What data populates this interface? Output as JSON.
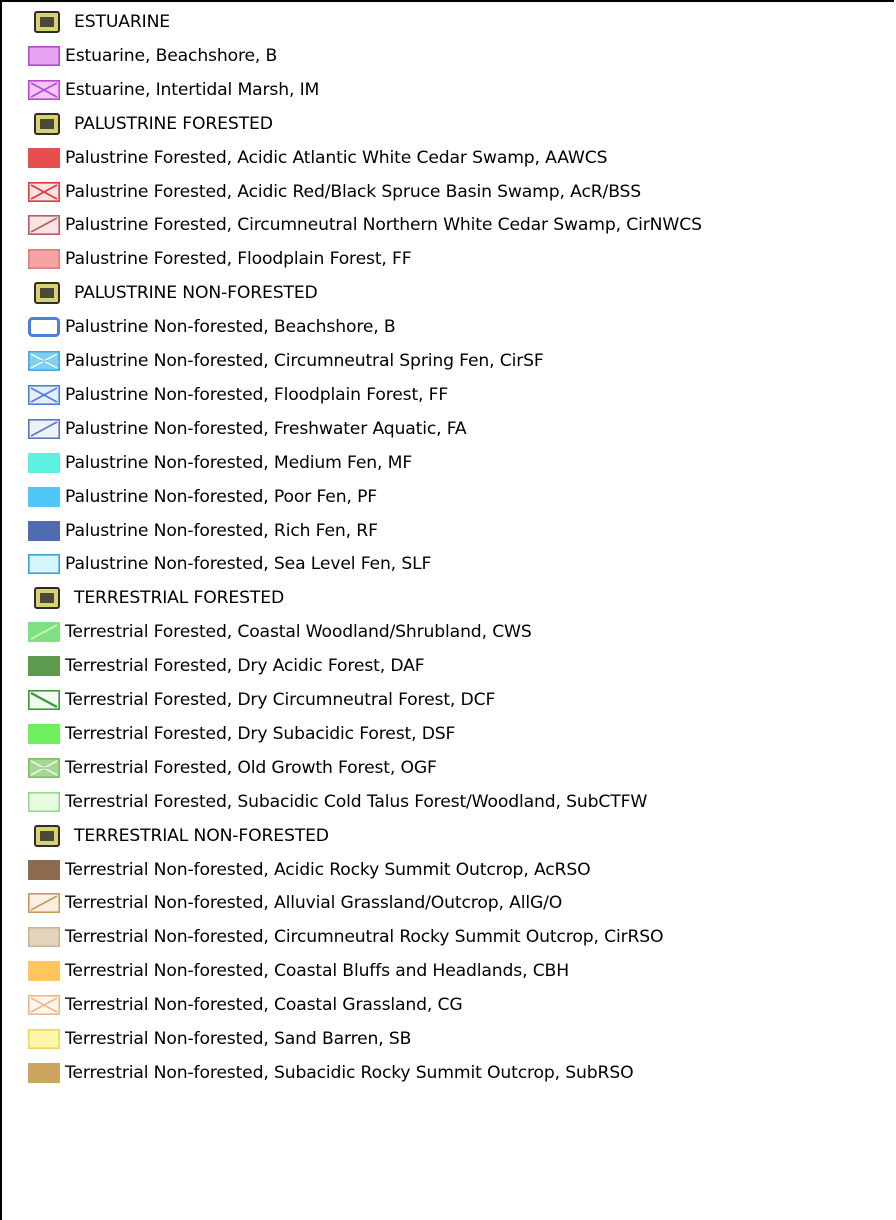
{
  "legend": {
    "rows": [
      {
        "kind": "header",
        "label": "ESTUARINE",
        "icon": "layer-group-icon"
      },
      {
        "kind": "item",
        "label": "Estuarine, Beachshore, B",
        "fill": "#e6a3f2",
        "border": "#b04bcc",
        "pattern": "solid"
      },
      {
        "kind": "item",
        "label": "Estuarine, Intertidal Marsh, IM",
        "fill": "#f3c8f8",
        "border": "#b84ad0",
        "pattern": "cross"
      },
      {
        "kind": "header",
        "label": "PALUSTRINE FORESTED",
        "icon": "layer-group-icon"
      },
      {
        "kind": "item",
        "label": "Palustrine Forested, Acidic Atlantic White Cedar Swamp, AAWCS",
        "fill": "#e94e4e",
        "border": "#e94e4e",
        "pattern": "solid"
      },
      {
        "kind": "item",
        "label": "Palustrine Forested, Acidic Red/Black Spruce Basin Swamp, AcR/BSS",
        "fill": "#fde2e2",
        "border": "#e03a3a",
        "pattern": "cross"
      },
      {
        "kind": "item",
        "label": "Palustrine Forested, Circumneutral Northern White Cedar Swamp, CirNWCS",
        "fill": "#fbe3e3",
        "border": "#b06060",
        "pattern": "diag"
      },
      {
        "kind": "item",
        "label": "Palustrine Forested, Floodplain Forest, FF",
        "fill": "#f5a3a3",
        "border": "#e47a7a",
        "pattern": "solid"
      },
      {
        "kind": "header",
        "label": "PALUSTRINE NON-FORESTED",
        "icon": "layer-group-icon"
      },
      {
        "kind": "item",
        "label": "Palustrine Non-forested, Beachshore, B",
        "fill": "#ffffff",
        "border": "#4a7fe0",
        "pattern": "hollow"
      },
      {
        "kind": "item",
        "label": "Palustrine Non-forested, Circumneutral Spring Fen, CirSF",
        "fill": "#7fd0f0",
        "border": "#4aa8e0",
        "pattern": "cross-fill"
      },
      {
        "kind": "item",
        "label": "Palustrine Non-forested, Floodplain Forest, FF",
        "fill": "#e6eefc",
        "border": "#4a7fe0",
        "pattern": "cross"
      },
      {
        "kind": "item",
        "label": "Palustrine Non-forested, Freshwater Aquatic, FA",
        "fill": "#eef2fb",
        "border": "#5a78c0",
        "pattern": "diag"
      },
      {
        "kind": "item",
        "label": "Palustrine Non-forested, Medium Fen, MF",
        "fill": "#5ef0e0",
        "border": "#5ef0e0",
        "pattern": "solid"
      },
      {
        "kind": "item",
        "label": "Palustrine Non-forested, Poor Fen, PF",
        "fill": "#4fc8f8",
        "border": "#4fc8f8",
        "pattern": "solid"
      },
      {
        "kind": "item",
        "label": "Palustrine Non-forested, Rich Fen, RF",
        "fill": "#4f6cb0",
        "border": "#4f6cb0",
        "pattern": "solid"
      },
      {
        "kind": "item",
        "label": "Palustrine Non-forested, Sea Level Fen, SLF",
        "fill": "#d6f6fc",
        "border": "#3aa0d8",
        "pattern": "solid"
      },
      {
        "kind": "header",
        "label": "TERRESTRIAL FORESTED",
        "icon": "layer-group-icon"
      },
      {
        "kind": "item",
        "label": "Terrestrial Forested, Coastal Woodland/Shrubland, CWS",
        "fill": "#7ee07e",
        "border": "#7ee07e",
        "pattern": "diag-light"
      },
      {
        "kind": "item",
        "label": "Terrestrial Forested, Dry Acidic Forest, DAF",
        "fill": "#5e9a4e",
        "border": "#5e9a4e",
        "pattern": "solid"
      },
      {
        "kind": "item",
        "label": "Terrestrial Forested, Dry Circumneutral Forest, DCF",
        "fill": "#f4fbf0",
        "border": "#3a9a3a",
        "pattern": "diag-back"
      },
      {
        "kind": "item",
        "label": "Terrestrial Forested, Dry Subacidic Forest, DSF",
        "fill": "#6ef05e",
        "border": "#6ef05e",
        "pattern": "solid"
      },
      {
        "kind": "item",
        "label": "Terrestrial Forested, Old Growth Forest, OGF",
        "fill": "#a4d890",
        "border": "#7ec060",
        "pattern": "cross-fill"
      },
      {
        "kind": "item",
        "label": "Terrestrial Forested, Subacidic Cold Talus Forest/Woodland, SubCTFW",
        "fill": "#e6fbe0",
        "border": "#9ad890",
        "pattern": "solid"
      },
      {
        "kind": "header",
        "label": "TERRESTRIAL NON-FORESTED",
        "icon": "layer-group-icon"
      },
      {
        "kind": "item",
        "label": "Terrestrial Non-forested, Acidic Rocky Summit Outcrop, AcRSO",
        "fill": "#8c6a50",
        "border": "#8c6a50",
        "pattern": "solid"
      },
      {
        "kind": "item",
        "label": "Terrestrial Non-forested, Alluvial Grassland/Outcrop, AllG/O",
        "fill": "#fbf0e0",
        "border": "#c89a5a",
        "pattern": "diag"
      },
      {
        "kind": "item",
        "label": "Terrestrial Non-forested, Circumneutral Rocky Summit Outcrop, CirRSO",
        "fill": "#e4d4bc",
        "border": "#c8b898",
        "pattern": "solid"
      },
      {
        "kind": "item",
        "label": "Terrestrial Non-forested, Coastal Bluffs and Headlands, CBH",
        "fill": "#ffc65e",
        "border": "#ffc65e",
        "pattern": "solid"
      },
      {
        "kind": "item",
        "label": "Terrestrial Non-forested, Coastal Grassland, CG",
        "fill": "#fff6ec",
        "border": "#e8b890",
        "pattern": "cross"
      },
      {
        "kind": "item",
        "label": "Terrestrial Non-forested, Sand Barren, SB",
        "fill": "#fff6a8",
        "border": "#e8d860",
        "pattern": "solid"
      },
      {
        "kind": "item",
        "label": "Terrestrial Non-forested, Subacidic Rocky Summit Outcrop, SubRSO",
        "fill": "#cca45e",
        "border": "#cca45e",
        "pattern": "solid"
      }
    ]
  }
}
